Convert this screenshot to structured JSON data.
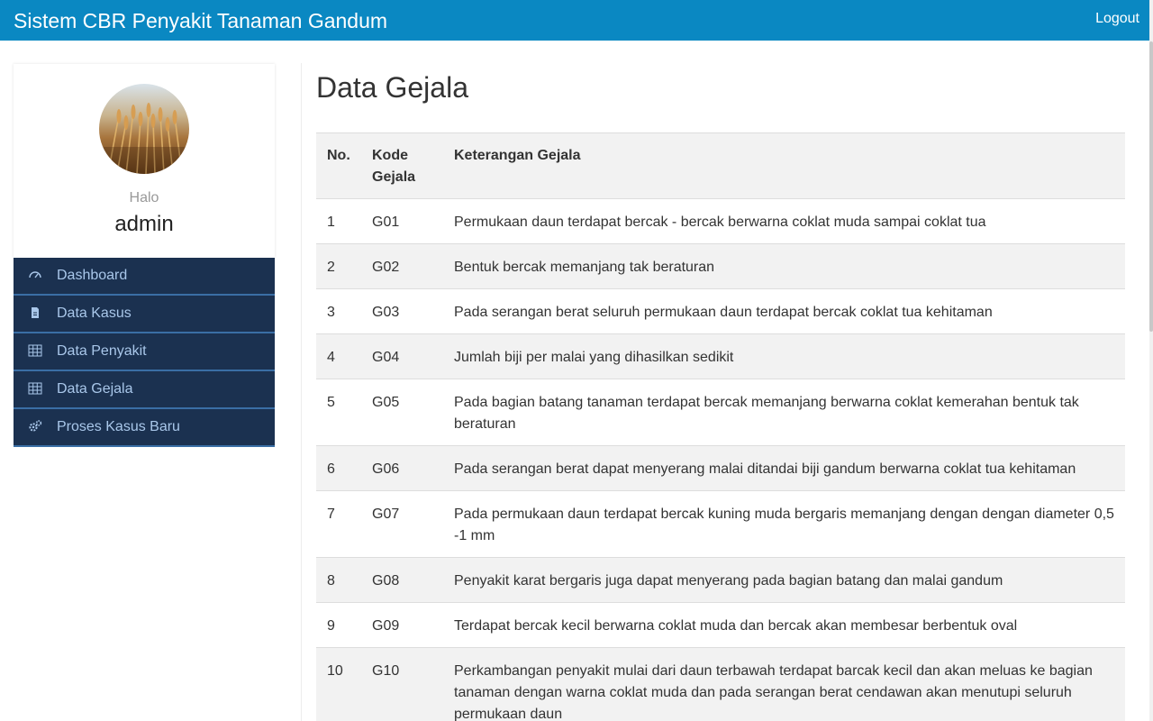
{
  "app": {
    "title": "Sistem CBR Penyakit Tanaman Gandum",
    "logout": "Logout"
  },
  "profile": {
    "greeting": "Halo",
    "username": "admin"
  },
  "menu": [
    {
      "label": "Dashboard",
      "icon": "dashboard-icon"
    },
    {
      "label": "Data Kasus",
      "icon": "file-icon"
    },
    {
      "label": "Data Penyakit",
      "icon": "table-icon"
    },
    {
      "label": "Data Gejala",
      "icon": "table-icon"
    },
    {
      "label": "Proses Kasus Baru",
      "icon": "gears-icon"
    }
  ],
  "page": {
    "title": "Data Gejala"
  },
  "table": {
    "headers": {
      "no": "No.",
      "kode_line1": "Kode",
      "kode_line2": "Gejala",
      "keterangan": "Keterangan Gejala"
    },
    "rows": [
      {
        "no": "1",
        "kode": "G01",
        "keterangan": "Permukaan daun terdapat bercak - bercak berwarna coklat muda sampai coklat tua"
      },
      {
        "no": "2",
        "kode": "G02",
        "keterangan": "Bentuk bercak memanjang tak beraturan"
      },
      {
        "no": "3",
        "kode": "G03",
        "keterangan": "Pada serangan berat seluruh permukaan daun terdapat bercak coklat tua kehitaman"
      },
      {
        "no": "4",
        "kode": "G04",
        "keterangan": "Jumlah biji per malai yang dihasilkan sedikit"
      },
      {
        "no": "5",
        "kode": "G05",
        "keterangan": "Pada bagian batang tanaman terdapat bercak memanjang berwarna coklat kemerahan bentuk tak beraturan"
      },
      {
        "no": "6",
        "kode": "G06",
        "keterangan": "Pada serangan berat dapat menyerang malai ditandai biji gandum berwarna coklat tua kehitaman"
      },
      {
        "no": "7",
        "kode": "G07",
        "keterangan": "Pada permukaan daun terdapat bercak kuning muda bergaris memanjang dengan dengan diameter 0,5 -1 mm"
      },
      {
        "no": "8",
        "kode": "G08",
        "keterangan": "Penyakit karat bergaris juga dapat menyerang pada bagian batang dan malai gandum"
      },
      {
        "no": "9",
        "kode": "G09",
        "keterangan": "Terdapat bercak kecil berwarna coklat muda dan bercak akan membesar berbentuk oval"
      },
      {
        "no": "10",
        "kode": "G10",
        "keterangan": "Perkambangan penyakit mulai dari daun terbawah terdapat barcak kecil dan akan meluas ke bagian tanaman dengan warna coklat muda dan pada serangan berat cendawan akan menutupi seluruh permukaan daun"
      }
    ]
  },
  "colors": {
    "navbar": "#0a88c2",
    "sidebar_menu": "#1b3150",
    "menu_text": "#a9c7ea",
    "menu_border": "#3a6ea5"
  }
}
